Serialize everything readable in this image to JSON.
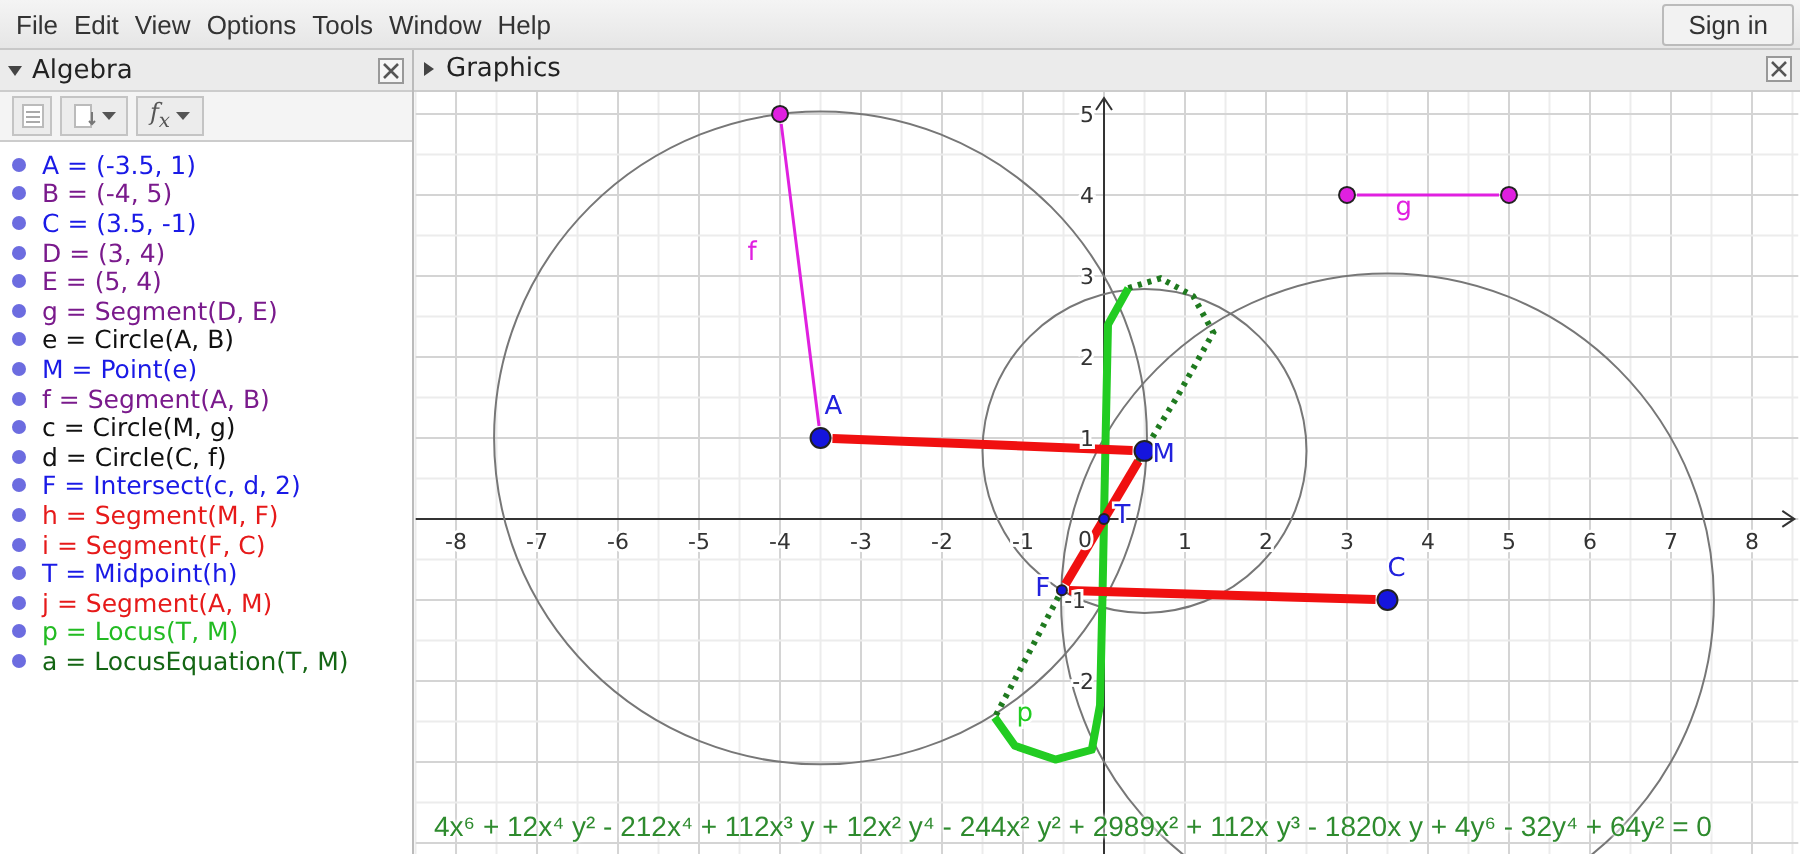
{
  "menu": [
    "File",
    "Edit",
    "View",
    "Options",
    "Tools",
    "Window",
    "Help"
  ],
  "sign_in": "Sign in",
  "algebra": {
    "title": "Algebra",
    "toolbar": [
      {
        "kind": "auxiliary"
      },
      {
        "kind": "sort"
      },
      {
        "kind": "formula",
        "label": "f$_{x}$"
      }
    ],
    "items": [
      {
        "text": "A = (-3.5, 1)",
        "color": "#1a1ae6"
      },
      {
        "text": "B = (-4, 5)",
        "color": "#7a1a8c"
      },
      {
        "text": "C = (3.5, -1)",
        "color": "#1a1ae6"
      },
      {
        "text": "D = (3, 4)",
        "color": "#7a1a8c"
      },
      {
        "text": "E = (5, 4)",
        "color": "#7a1a8c"
      },
      {
        "text": "g = Segment(D, E)",
        "color": "#7a1a8c"
      },
      {
        "text": "e = Circle(A, B)",
        "color": "#111111"
      },
      {
        "text": "M = Point(e)",
        "color": "#1a1ae6"
      },
      {
        "text": "f = Segment(A, B)",
        "color": "#7a1a8c"
      },
      {
        "text": "c = Circle(M, g)",
        "color": "#111111"
      },
      {
        "text": "d = Circle(C, f)",
        "color": "#111111"
      },
      {
        "text": "F = Intersect(c, d, 2)",
        "color": "#1a1ae6"
      },
      {
        "text": "h = Segment(M, F)",
        "color": "#e61a1a"
      },
      {
        "text": "i = Segment(F, C)",
        "color": "#e61a1a"
      },
      {
        "text": "T = Midpoint(h)",
        "color": "#1a1ae6"
      },
      {
        "text": "j = Segment(A, M)",
        "color": "#e61a1a"
      },
      {
        "text": "p = Locus(T, M)",
        "color": "#22bb22"
      },
      {
        "text": "a = LocusEquation(T, M)",
        "color": "#146614"
      }
    ]
  },
  "graphics": {
    "title": "Graphics",
    "x_ticks": [
      "-8",
      "-7",
      "-6",
      "-5",
      "-4",
      "-3",
      "-2",
      "-1",
      "1",
      "2",
      "3",
      "4",
      "5",
      "6",
      "7",
      "8"
    ],
    "y_ticks": [
      "5",
      "4",
      "3",
      "2",
      "1",
      "-1",
      "-2"
    ],
    "origin": "0",
    "labels": [
      {
        "text": "A",
        "kind": "point"
      },
      {
        "text": "M",
        "kind": "point"
      },
      {
        "text": "T",
        "kind": "point"
      },
      {
        "text": "F",
        "kind": "point"
      },
      {
        "text": "C",
        "kind": "point"
      },
      {
        "text": "f",
        "kind": "segment"
      },
      {
        "text": "g",
        "kind": "segment"
      },
      {
        "text": "p",
        "kind": "locus"
      }
    ],
    "equation": "4x⁶ + 12x⁴ y² - 212x⁴ + 112x³ y + 12x² y⁴ - 244x² y² + 2989x² + 112x y³ - 1820x y + 4y⁶ - 32y⁴ + 64y² = 0"
  }
}
